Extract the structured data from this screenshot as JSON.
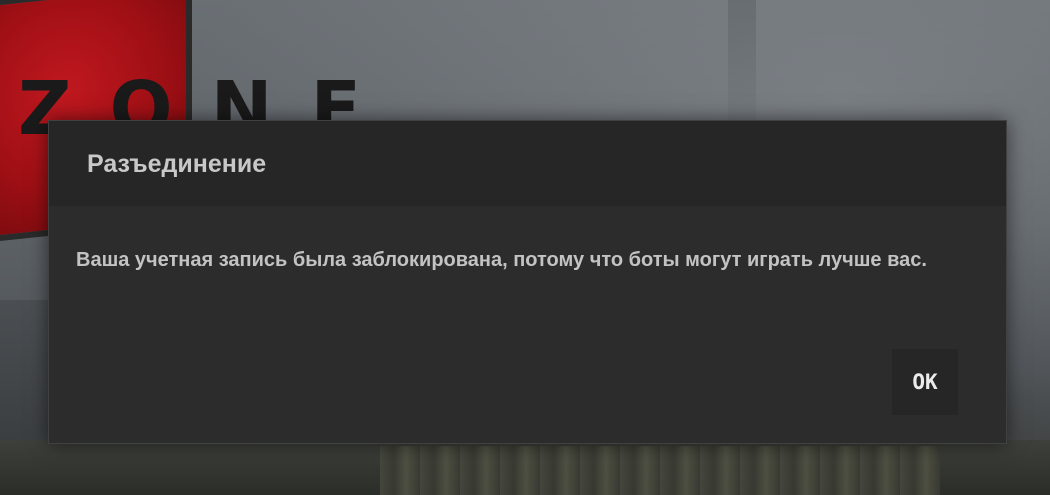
{
  "background": {
    "logo_text": "ZONE"
  },
  "dialog": {
    "title": "Разъединение",
    "message": "Ваша учетная запись была заблокирована, потому что боты могут играть лучше вас.",
    "ok_label": "OK"
  }
}
